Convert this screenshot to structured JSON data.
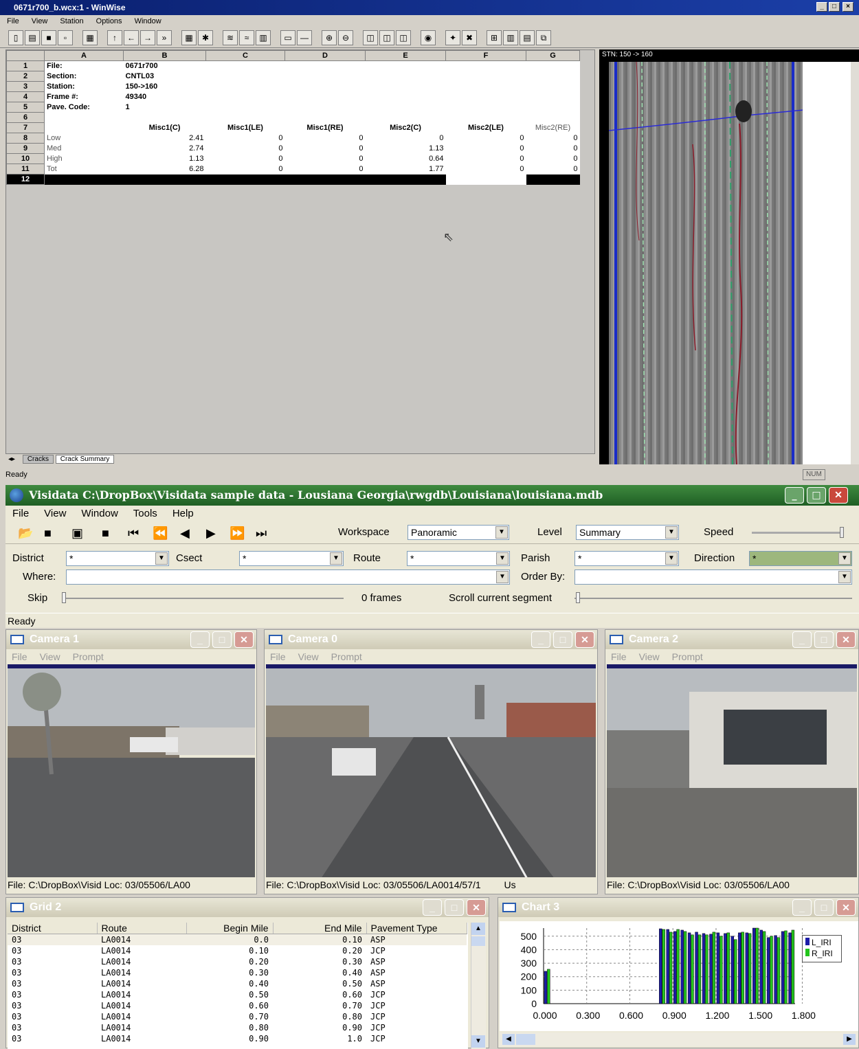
{
  "winwise": {
    "title": "0671r700_b.wcx:1 - WinWise",
    "menu": [
      "File",
      "View",
      "Station",
      "Options",
      "Window"
    ],
    "sheet": {
      "columns": [
        "A",
        "B",
        "C",
        "D",
        "E",
        "F",
        "G"
      ],
      "info": [
        {
          "row": "1",
          "label": "File:",
          "value": "0671r700"
        },
        {
          "row": "2",
          "label": "Section:",
          "value": "CNTL03"
        },
        {
          "row": "3",
          "label": "Station:",
          "value": "150->160"
        },
        {
          "row": "4",
          "label": "Frame #:",
          "value": "49340"
        },
        {
          "row": "5",
          "label": "Pave. Code:",
          "value": "1"
        },
        {
          "row": "6",
          "label": "",
          "value": ""
        }
      ],
      "header_row": "7",
      "headers": [
        "Misc1(C)",
        "Misc1(LE)",
        "Misc1(RE)",
        "Misc2(C)",
        "Misc2(LE)",
        "Misc2(RE)"
      ],
      "data": [
        {
          "row": "8",
          "label": "Low",
          "values": [
            "2.41",
            "0",
            "0",
            "0",
            "0",
            "0"
          ]
        },
        {
          "row": "9",
          "label": "Med",
          "values": [
            "2.74",
            "0",
            "0",
            "1.13",
            "0",
            "0"
          ]
        },
        {
          "row": "10",
          "label": "High",
          "values": [
            "1.13",
            "0",
            "0",
            "0.64",
            "0",
            "0"
          ]
        },
        {
          "row": "11",
          "label": "Tot",
          "values": [
            "6.28",
            "0",
            "0",
            "1.77",
            "0",
            "0"
          ]
        }
      ],
      "selected_row": "12",
      "tabs": [
        "Cracks",
        "Crack Summary"
      ]
    },
    "scan_label": "STN: 150 -> 160",
    "status": "Ready",
    "status_num": "NUM"
  },
  "visidata": {
    "title": "Visidata C:\\DropBox\\Visidata sample data - Lousiana Georgia\\rwgdb\\Louisiana\\louisiana.mdb",
    "menu": [
      "File",
      "View",
      "Window",
      "Tools",
      "Help"
    ],
    "workspace_label": "Workspace",
    "workspace_value": "Panoramic",
    "level_label": "Level",
    "level_value": "Summary",
    "speed_label": "Speed",
    "district_label": "District",
    "district_value": "*",
    "csect_label": "Csect",
    "csect_value": "*",
    "route_label": "Route",
    "route_value": "*",
    "parish_label": "Parish",
    "parish_value": "*",
    "direction_label": "Direction",
    "direction_value": "*",
    "where_label": "Where:",
    "orderby_label": "Order By:",
    "skip_label": "Skip",
    "frames_text": "0 frames",
    "scroll_label": "Scroll current segment",
    "status": "Ready",
    "child_menu": [
      "File",
      "View",
      "Prompt"
    ],
    "cameras": [
      {
        "title": "Camera 1",
        "status_file": "File: C:\\DropBox\\Visid",
        "status_loc": "Loc: 03/05506/LA00",
        "status_extra": ""
      },
      {
        "title": "Camera 0",
        "status_file": "File: C:\\DropBox\\Visid",
        "status_loc": "Loc: 03/05506/LA0014/57/1",
        "status_extra": "Us"
      },
      {
        "title": "Camera 2",
        "status_file": "File: C:\\DropBox\\Visid",
        "status_loc": "Loc: 03/05506/LA00",
        "status_extra": ""
      }
    ],
    "grid": {
      "title": "Grid 2",
      "headers": [
        "District",
        "Route",
        "Begin Mile",
        "End Mile",
        "Pavement Type"
      ],
      "rows": [
        [
          "03",
          "LA0014",
          "0.0",
          "0.10",
          "ASP"
        ],
        [
          "03",
          "LA0014",
          "0.10",
          "0.20",
          "JCP"
        ],
        [
          "03",
          "LA0014",
          "0.20",
          "0.30",
          "ASP"
        ],
        [
          "03",
          "LA0014",
          "0.30",
          "0.40",
          "ASP"
        ],
        [
          "03",
          "LA0014",
          "0.40",
          "0.50",
          "ASP"
        ],
        [
          "03",
          "LA0014",
          "0.50",
          "0.60",
          "JCP"
        ],
        [
          "03",
          "LA0014",
          "0.60",
          "0.70",
          "JCP"
        ],
        [
          "03",
          "LA0014",
          "0.70",
          "0.80",
          "JCP"
        ],
        [
          "03",
          "LA0014",
          "0.80",
          "0.90",
          "JCP"
        ],
        [
          "03",
          "LA0014",
          "0.90",
          "1.0",
          "JCP"
        ]
      ]
    },
    "chart_title": "Chart 3"
  },
  "chart_data": {
    "type": "bar",
    "title": "",
    "series": [
      {
        "name": "L_IRI",
        "color": "#1c1ca8",
        "values": [
          240,
          0,
          0,
          0,
          0,
          0,
          0,
          0,
          0,
          0,
          0,
          0,
          0,
          0,
          0,
          0,
          555,
          550,
          535,
          545,
          525,
          530,
          520,
          515,
          525,
          520,
          500,
          525,
          525,
          560,
          545,
          490,
          505,
          535,
          525
        ]
      },
      {
        "name": "R_IRI",
        "color": "#22c41c",
        "values": [
          255,
          0,
          0,
          0,
          0,
          0,
          0,
          0,
          0,
          0,
          0,
          0,
          0,
          0,
          0,
          0,
          550,
          530,
          550,
          535,
          510,
          510,
          510,
          530,
          500,
          525,
          475,
          530,
          520,
          560,
          535,
          500,
          490,
          540,
          545
        ]
      }
    ],
    "x_start": 0.0,
    "x_step": 0.05,
    "xticks": [
      "0.000",
      "0.300",
      "0.600",
      "0.900",
      "1.200",
      "1.500",
      "1.800"
    ],
    "yticks": [
      "0",
      "100",
      "200",
      "300",
      "400",
      "500"
    ],
    "ylim": [
      0,
      560
    ],
    "grid": true,
    "legend": "right"
  }
}
